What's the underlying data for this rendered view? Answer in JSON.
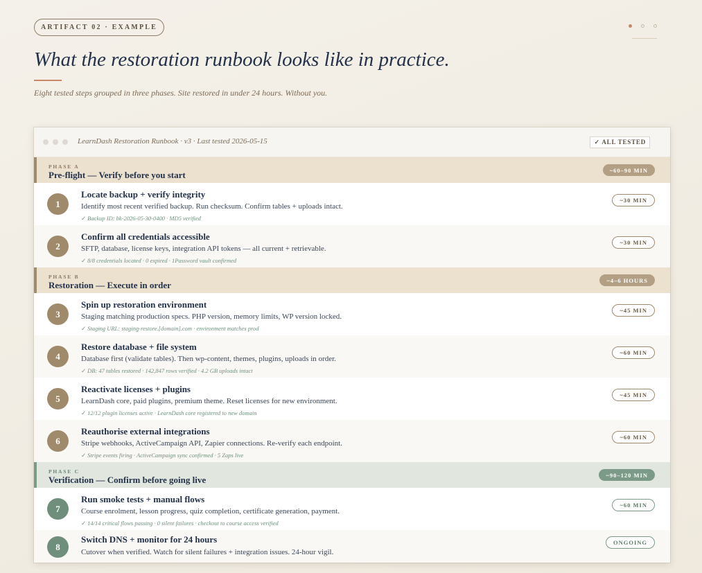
{
  "artifact_label": "ARTIFACT 02 · EXAMPLE",
  "headline": "What the restoration runbook looks like in practice.",
  "subheadline": "Eight tested steps grouped in three phases. Site restored in under 24 hours. Without you.",
  "runbook": {
    "title": "LearnDash Restoration Runbook · v3 · Last tested 2026-05-15",
    "status_badge": "✓ ALL TESTED",
    "phases": [
      {
        "label": "PHASE A",
        "title": "Pre-flight — Verify before you start",
        "duration": "~60–90 MIN",
        "color": "#b39f84",
        "steps": [
          {
            "number": "1",
            "title": "Locate backup + verify integrity",
            "description": "Identify most recent verified backup. Run checksum. Confirm tables + uploads intact.",
            "note": "Backup ID: bk-2026-05-30-0400 · MD5 verified",
            "duration": "~30 MIN"
          },
          {
            "number": "2",
            "title": "Confirm all credentials accessible",
            "description": "SFTP, database, license keys, integration API tokens — all current + retrievable.",
            "note": "8/8 credentials located · 0 expired · 1Password vault confirmed",
            "duration": "~30 MIN"
          }
        ]
      },
      {
        "label": "PHASE B",
        "title": "Restoration — Execute in order",
        "duration": "~4–6 HOURS",
        "color": "#b39f84",
        "steps": [
          {
            "number": "3",
            "title": "Spin up restoration environment",
            "description": "Staging matching production specs. PHP version, memory limits, WP version locked.",
            "note": "Staging URL: staging-restore.[domain].com · environment matches prod",
            "duration": "~45 MIN"
          },
          {
            "number": "4",
            "title": "Restore database + file system",
            "description": "Database first (validate tables). Then wp-content, themes, plugins, uploads in order.",
            "note": "DB: 47 tables restored · 142,847 rows verified · 4.2 GB uploads intact",
            "duration": "~60 MIN"
          },
          {
            "number": "5",
            "title": "Reactivate licenses + plugins",
            "description": "LearnDash core, paid plugins, premium theme. Reset licenses for new environment.",
            "note": "12/12 plugin licenses active · LearnDash core registered to new domain",
            "duration": "~45 MIN"
          },
          {
            "number": "6",
            "title": "Reauthorise external integrations",
            "description": "Stripe webhooks, ActiveCampaign API, Zapier connections. Re-verify each endpoint.",
            "note": "Stripe events firing · ActiveCampaign sync confirmed · 5 Zaps live",
            "duration": "~60 MIN"
          }
        ]
      },
      {
        "label": "PHASE C",
        "title": "Verification — Confirm before going live",
        "duration": "~90–120 MIN",
        "color": "#7b9a87",
        "steps": [
          {
            "number": "7",
            "title": "Run smoke tests + manual flows",
            "description": "Course enrolment, lesson progress, quiz completion, certificate generation, payment.",
            "note": "14/14 critical flows passing · 0 silent failures · checkout to course access verified",
            "duration": "~60 MIN"
          },
          {
            "number": "8",
            "title": "Switch DNS + monitor for 24 hours",
            "description": "Cutover when verified. Watch for silent failures + integration issues. 24-hour vigil.",
            "note": "",
            "duration": "ONGOING"
          }
        ]
      }
    ]
  }
}
